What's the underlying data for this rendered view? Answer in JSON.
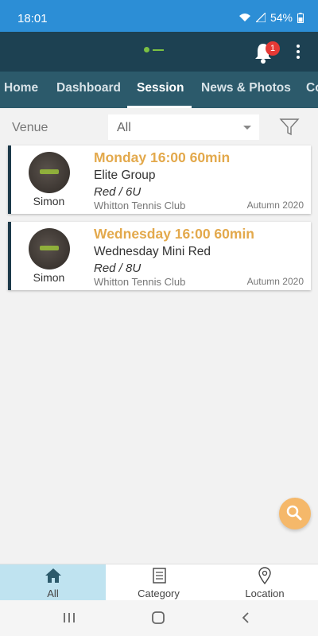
{
  "status_bar": {
    "time": "18:01",
    "battery": "54%"
  },
  "header": {
    "notification_count": "1"
  },
  "tabs": [
    {
      "label": "Home"
    },
    {
      "label": "Dashboard"
    },
    {
      "label": "Session"
    },
    {
      "label": "News & Photos"
    },
    {
      "label": "Co"
    }
  ],
  "filter": {
    "label": "Venue",
    "value": "All"
  },
  "sessions": [
    {
      "coach": "Simon",
      "title": "Monday 16:00 60min",
      "group": "Elite Group",
      "level": "Red / 6U",
      "club": "Whitton Tennis Club",
      "term": "Autumn 2020"
    },
    {
      "coach": "Simon",
      "title": "Wednesday 16:00 60min",
      "group": "Wednesday Mini Red",
      "level": "Red / 8U",
      "club": "Whitton Tennis Club",
      "term": "Autumn 2020"
    }
  ],
  "bottom_nav": [
    {
      "label": "All",
      "icon": "home-icon"
    },
    {
      "label": "Category",
      "icon": "list-icon"
    },
    {
      "label": "Location",
      "icon": "location-pin-icon"
    }
  ],
  "colors": {
    "status_bar": "#2c8ed6",
    "app_bar": "#1d4152",
    "tabs": "#2c5a6b",
    "accent": "#e3a94c",
    "active_nav": "#bfe3f0"
  }
}
